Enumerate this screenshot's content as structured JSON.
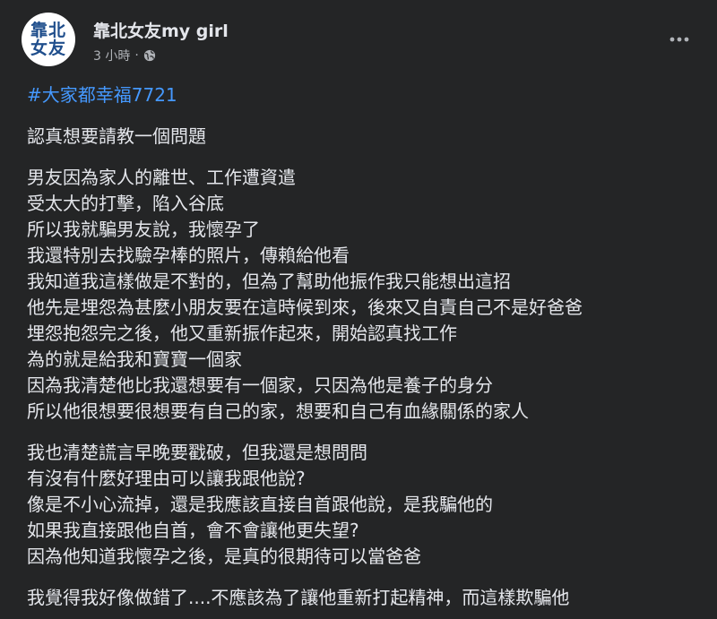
{
  "post": {
    "page_name": "靠北女友my girl",
    "avatar_text": [
      "靠北",
      "女友"
    ],
    "timestamp": "3 小時",
    "separator": "·",
    "privacy_icon": "globe-icon",
    "more_icon": "more-horizontal-icon",
    "hashtag": "#大家都幸福7721",
    "paragraphs": [
      [
        "認真想要請教一個問題"
      ],
      [
        "男友因為家人的離世、工作遭資遣",
        "受太大的打擊，陷入谷底",
        "所以我就騙男友說，我懷孕了",
        "我還特別去找驗孕棒的照片，傳賴給他看",
        "我知道我這樣做是不對的，但為了幫助他振作我只能想出這招",
        "他先是埋怨為甚麼小朋友要在這時候到來，後來又自責自己不是好爸爸",
        "埋怨抱怨完之後，他又重新振作起來，開始認真找工作",
        "為的就是給我和寶寶一個家",
        "因為我清楚他比我還想要有一個家，只因為他是養子的身分",
        "所以他很想要很想要有自己的家，想要和自己有血緣關係的家人"
      ],
      [
        "我也清楚謊言早晚要戳破，但我還是想問問",
        "有沒有什麼好理由可以讓我跟他說?",
        "像是不小心流掉，還是我應該直接自首跟他說，是我騙他的",
        "如果我直接跟他自首，會不會讓他更失望?",
        "因為他知道我懷孕之後，是真的很期待可以當爸爸"
      ],
      [
        "我覺得我好像做錯了....不應該為了讓他重新打起精神，而這樣欺騙他"
      ]
    ],
    "colors": {
      "background": "#242526",
      "text": "#e4e6eb",
      "secondary_text": "#b0b3b8",
      "hashtag": "#4599ff",
      "avatar_text": "#1f4e8c"
    }
  }
}
